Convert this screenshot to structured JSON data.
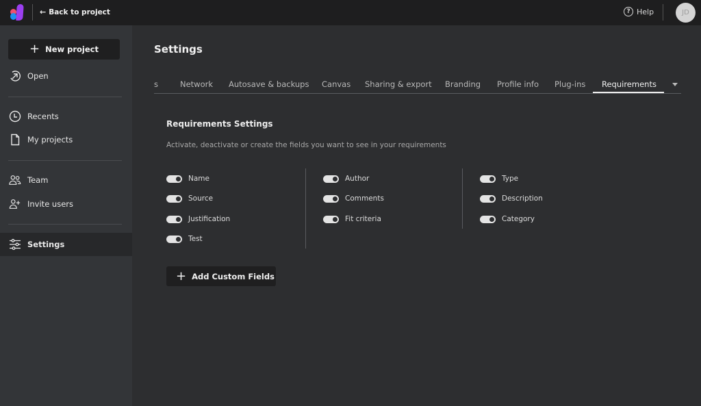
{
  "topbar": {
    "back_label": "Back to project",
    "help_label": "Help",
    "avatar_initials": "JD"
  },
  "sidebar": {
    "new_project_label": "New project",
    "items": [
      {
        "label": "Open",
        "icon": "open-arrow-icon"
      },
      {
        "label": "Recents",
        "icon": "clock-icon"
      },
      {
        "label": "My projects",
        "icon": "document-icon"
      },
      {
        "label": "Team",
        "icon": "team-icon"
      },
      {
        "label": "Invite users",
        "icon": "invite-user-icon"
      },
      {
        "label": "Settings",
        "icon": "sliders-icon",
        "active": true
      }
    ]
  },
  "main": {
    "title": "Settings",
    "tabs": [
      {
        "label": "...ces"
      },
      {
        "label": "Network"
      },
      {
        "label": "Autosave & backups"
      },
      {
        "label": "Canvas"
      },
      {
        "label": "Sharing & export"
      },
      {
        "label": "Branding"
      },
      {
        "label": "Profile info"
      },
      {
        "label": "Plug-ins"
      },
      {
        "label": "Requirements",
        "active": true
      }
    ],
    "section_title": "Requirements Settings",
    "section_desc": "Activate, deactivate or create the fields you want to see in your requirements",
    "columns": [
      [
        {
          "label": "Name",
          "enabled": true
        },
        {
          "label": "Source",
          "enabled": true
        },
        {
          "label": "Justification",
          "enabled": true
        },
        {
          "label": "Test",
          "enabled": true
        }
      ],
      [
        {
          "label": "Author",
          "enabled": true
        },
        {
          "label": "Comments",
          "enabled": true
        },
        {
          "label": "Fit criteria",
          "enabled": true
        }
      ],
      [
        {
          "label": "Type",
          "enabled": true
        },
        {
          "label": "Description",
          "enabled": true
        },
        {
          "label": "Category",
          "enabled": true
        }
      ]
    ],
    "add_custom_label": "Add Custom Fields"
  },
  "colors": {
    "topbar_bg": "#1e1e1f",
    "sidebar_bg": "#333538",
    "main_bg": "#2d2e30",
    "logo_purple": "#9b3ff0",
    "logo_red": "#f0506e",
    "logo_blue": "#1e90f0"
  }
}
